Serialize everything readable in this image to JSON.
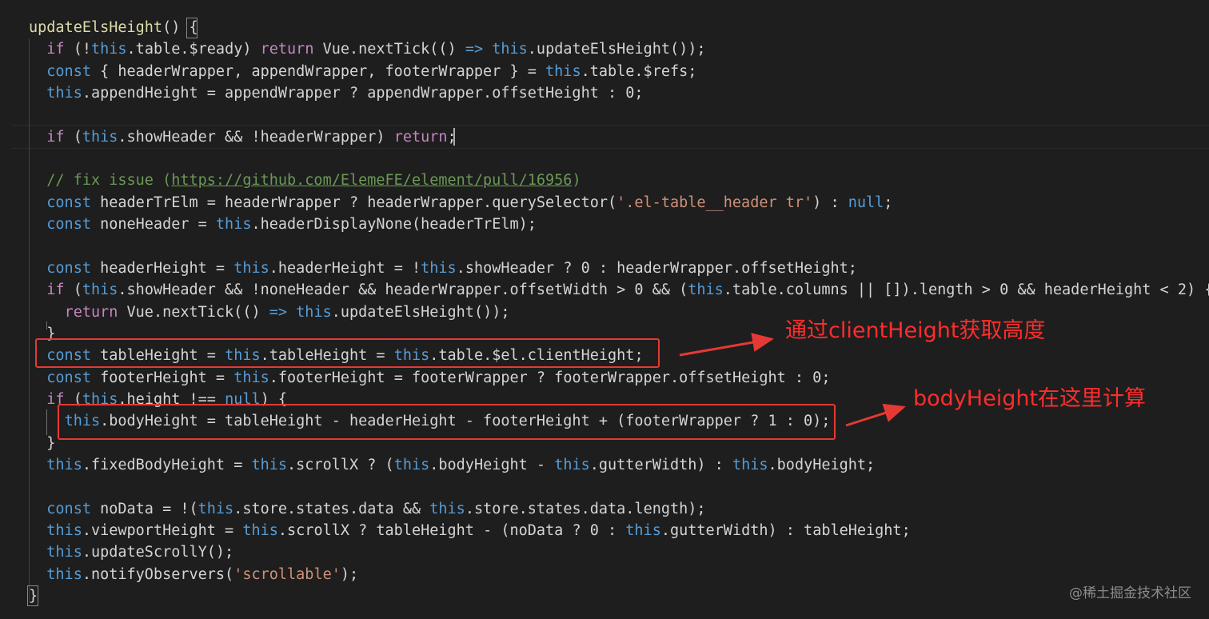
{
  "editor": {
    "lines": [
      [
        {
          "t": "updateElsHeight",
          "c": "fn"
        },
        {
          "t": "() "
        },
        {
          "t": "{"
        }
      ],
      [
        {
          "t": "  "
        },
        {
          "t": "if",
          "c": "ctl"
        },
        {
          "t": " (!"
        },
        {
          "t": "this",
          "c": "kw"
        },
        {
          "t": ".table.$ready) "
        },
        {
          "t": "return",
          "c": "ctl"
        },
        {
          "t": " Vue.nextTick(() "
        },
        {
          "t": "=>",
          "c": "kw"
        },
        {
          "t": " "
        },
        {
          "t": "this",
          "c": "kw"
        },
        {
          "t": ".updateElsHeight());"
        }
      ],
      [
        {
          "t": "  "
        },
        {
          "t": "const",
          "c": "kw"
        },
        {
          "t": " { headerWrapper, appendWrapper, footerWrapper } = "
        },
        {
          "t": "this",
          "c": "kw"
        },
        {
          "t": ".table.$refs;"
        }
      ],
      [
        {
          "t": "  "
        },
        {
          "t": "this",
          "c": "kw"
        },
        {
          "t": ".appendHeight = appendWrapper ? appendWrapper.offsetHeight : 0;"
        }
      ],
      [],
      [
        {
          "t": "  "
        },
        {
          "t": "if",
          "c": "ctl"
        },
        {
          "t": " ("
        },
        {
          "t": "this",
          "c": "kw"
        },
        {
          "t": ".showHeader && !headerWrapper) "
        },
        {
          "t": "return",
          "c": "ctl"
        },
        {
          "t": ";"
        }
      ],
      [],
      [
        {
          "t": "  "
        },
        {
          "t": "// fix issue (",
          "c": "com"
        },
        {
          "t": "https://github.com/ElemeFE/element/pull/16956",
          "c": "com-link"
        },
        {
          "t": ")",
          "c": "com"
        }
      ],
      [
        {
          "t": "  "
        },
        {
          "t": "const",
          "c": "kw"
        },
        {
          "t": " headerTrElm = headerWrapper ? headerWrapper.querySelector("
        },
        {
          "t": "'.el-table__header tr'",
          "c": "str"
        },
        {
          "t": ") : "
        },
        {
          "t": "null",
          "c": "kw"
        },
        {
          "t": ";"
        }
      ],
      [
        {
          "t": "  "
        },
        {
          "t": "const",
          "c": "kw"
        },
        {
          "t": " noneHeader = "
        },
        {
          "t": "this",
          "c": "kw"
        },
        {
          "t": ".headerDisplayNone(headerTrElm);"
        }
      ],
      [],
      [
        {
          "t": "  "
        },
        {
          "t": "const",
          "c": "kw"
        },
        {
          "t": " headerHeight = "
        },
        {
          "t": "this",
          "c": "kw"
        },
        {
          "t": ".headerHeight = !"
        },
        {
          "t": "this",
          "c": "kw"
        },
        {
          "t": ".showHeader ? 0 : headerWrapper.offsetHeight;"
        }
      ],
      [
        {
          "t": "  "
        },
        {
          "t": "if",
          "c": "ctl"
        },
        {
          "t": " ("
        },
        {
          "t": "this",
          "c": "kw"
        },
        {
          "t": ".showHeader && !noneHeader && headerWrapper.offsetWidth > 0 && ("
        },
        {
          "t": "this",
          "c": "kw"
        },
        {
          "t": ".table.columns || []).length > 0 && headerHeight < 2) {"
        }
      ],
      [
        {
          "t": "    "
        },
        {
          "t": "return",
          "c": "ctl"
        },
        {
          "t": " Vue.nextTick(() "
        },
        {
          "t": "=>",
          "c": "kw"
        },
        {
          "t": " "
        },
        {
          "t": "this",
          "c": "kw"
        },
        {
          "t": ".updateElsHeight());"
        }
      ],
      [
        {
          "t": "  }"
        }
      ],
      [
        {
          "t": "  "
        },
        {
          "t": "const",
          "c": "kw"
        },
        {
          "t": " tableHeight = "
        },
        {
          "t": "this",
          "c": "kw"
        },
        {
          "t": ".tableHeight = "
        },
        {
          "t": "this",
          "c": "kw"
        },
        {
          "t": ".table.$el.clientHeight;"
        }
      ],
      [
        {
          "t": "  "
        },
        {
          "t": "const",
          "c": "kw"
        },
        {
          "t": " footerHeight = "
        },
        {
          "t": "this",
          "c": "kw"
        },
        {
          "t": ".footerHeight = footerWrapper ? footerWrapper.offsetHeight : 0;"
        }
      ],
      [
        {
          "t": "  "
        },
        {
          "t": "if",
          "c": "ctl"
        },
        {
          "t": " ("
        },
        {
          "t": "this",
          "c": "kw"
        },
        {
          "t": ".height !== "
        },
        {
          "t": "null",
          "c": "kw"
        },
        {
          "t": ") {"
        }
      ],
      [
        {
          "t": "    "
        },
        {
          "t": "this",
          "c": "kw"
        },
        {
          "t": ".bodyHeight = tableHeight - headerHeight - footerHeight + (footerWrapper ? 1 : 0);"
        }
      ],
      [
        {
          "t": "  }"
        }
      ],
      [
        {
          "t": "  "
        },
        {
          "t": "this",
          "c": "kw"
        },
        {
          "t": ".fixedBodyHeight = "
        },
        {
          "t": "this",
          "c": "kw"
        },
        {
          "t": ".scrollX ? ("
        },
        {
          "t": "this",
          "c": "kw"
        },
        {
          "t": ".bodyHeight - "
        },
        {
          "t": "this",
          "c": "kw"
        },
        {
          "t": ".gutterWidth) : "
        },
        {
          "t": "this",
          "c": "kw"
        },
        {
          "t": ".bodyHeight;"
        }
      ],
      [],
      [
        {
          "t": "  "
        },
        {
          "t": "const",
          "c": "kw"
        },
        {
          "t": " noData = !("
        },
        {
          "t": "this",
          "c": "kw"
        },
        {
          "t": ".store.states.data && "
        },
        {
          "t": "this",
          "c": "kw"
        },
        {
          "t": ".store.states.data.length);"
        }
      ],
      [
        {
          "t": "  "
        },
        {
          "t": "this",
          "c": "kw"
        },
        {
          "t": ".viewportHeight = "
        },
        {
          "t": "this",
          "c": "kw"
        },
        {
          "t": ".scrollX ? tableHeight - (noData ? 0 : "
        },
        {
          "t": "this",
          "c": "kw"
        },
        {
          "t": ".gutterWidth) : tableHeight;"
        }
      ],
      [
        {
          "t": "  "
        },
        {
          "t": "this",
          "c": "kw"
        },
        {
          "t": ".updateScrollY();"
        }
      ],
      [
        {
          "t": "  "
        },
        {
          "t": "this",
          "c": "kw"
        },
        {
          "t": ".notifyObservers("
        },
        {
          "t": "'scrollable'",
          "c": "str"
        },
        {
          "t": ");"
        }
      ],
      [
        {
          "t": "}"
        }
      ]
    ]
  },
  "annotations": {
    "note_client_height": "通过clientHeight获取高度",
    "note_body_height": "bodyHeight在这里计算",
    "color": "#e53935"
  },
  "watermark": "@稀土掘金技术社区"
}
